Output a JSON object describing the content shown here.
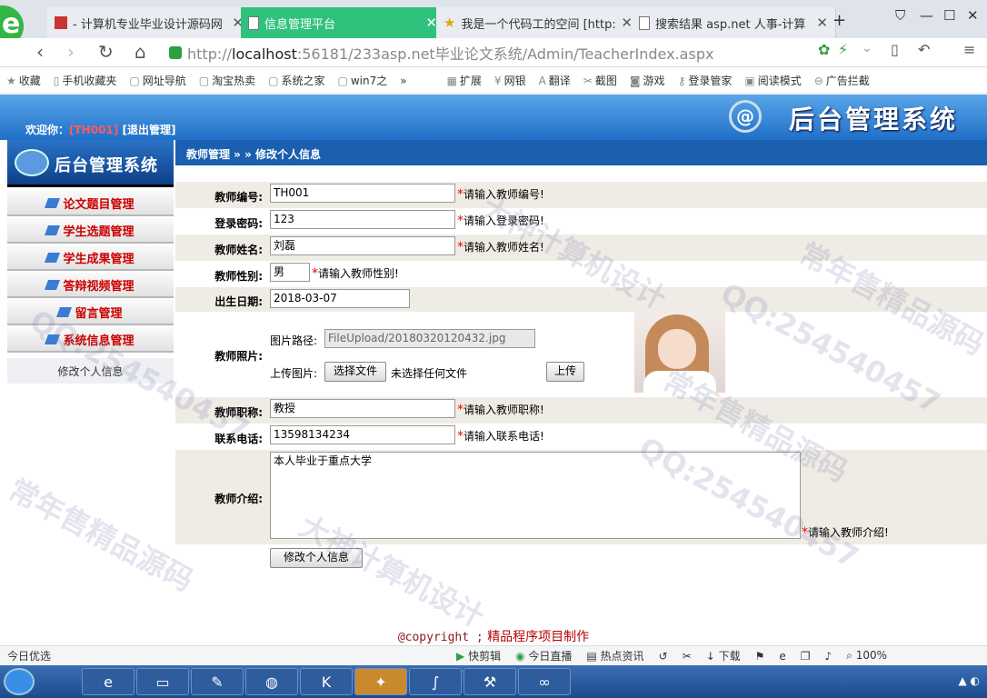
{
  "browser": {
    "tabs": [
      {
        "title": "- 计算机专业毕业设计源码网"
      },
      {
        "title": "信息管理平台"
      },
      {
        "title": "我是一个代码工的空间 [http:"
      },
      {
        "title": "搜索结果 asp.net 人事-计算"
      }
    ],
    "new_tab": "+",
    "address_host": "localhost",
    "address_prefix": "http://",
    "address_rest": ":56181/233asp.net毕业论文系统/Admin/TeacherIndex.aspx",
    "bookmarks": [
      "收藏",
      "手机收藏夹",
      "网址导航",
      "淘宝热卖",
      "系统之家",
      "win7之",
      "»",
      "扩展",
      "网银",
      "翻译",
      "截图",
      "游戏",
      "登录管家",
      "阅读模式",
      "广告拦截"
    ]
  },
  "header": {
    "logo": "后台管理系统",
    "welcome_prefix": "欢迎你：",
    "user_id": "[TH001]",
    "logout": "[退出管理]"
  },
  "breadcrumb": "教师管理 » » 修改个人信息",
  "sidebar": {
    "logo": "后台管理系统",
    "items": [
      "论文题目管理",
      "学生选题管理",
      "学生成果管理",
      "答辩视频管理",
      "留言管理",
      "系统信息管理"
    ],
    "sub_item": "修改个人信息"
  },
  "form": {
    "teacher_no": {
      "label": "教师编号:",
      "value": "TH001",
      "hint": "请输入教师编号!"
    },
    "password": {
      "label": "登录密码:",
      "value": "123",
      "hint": "请输入登录密码!"
    },
    "name": {
      "label": "教师姓名:",
      "value": "刘磊",
      "hint": "请输入教师姓名!"
    },
    "gender": {
      "label": "教师性别:",
      "value": "男",
      "hint": "请输入教师性别!"
    },
    "birth": {
      "label": "出生日期:",
      "value": "2018-03-07"
    },
    "photo": {
      "label": "教师照片:",
      "path_label": "图片路径:",
      "path_value": "FileUpload/20180320120432.jpg",
      "upload_label": "上传图片:",
      "choose_button": "选择文件",
      "no_file": "未选择任何文件",
      "upload_button": "上传"
    },
    "title": {
      "label": "教师职称:",
      "value": "教授",
      "hint": "请输入教师职称!"
    },
    "phone": {
      "label": "联系电话:",
      "value": "13598134234",
      "hint": "请输入联系电话!"
    },
    "intro": {
      "label": "教师介绍:",
      "value": "本人毕业于重点大学",
      "hint": "请输入教师介绍!"
    },
    "submit": "修改个人信息"
  },
  "footer": {
    "copyright": "@copyright ;",
    "text": "精品程序项目制作"
  },
  "status_bar": {
    "left": "今日优选",
    "items": [
      "快剪辑",
      "今日直播",
      "热点资讯",
      "下载",
      "100%"
    ]
  },
  "watermarks": [
    "QQ:254540457",
    "大神计算机设计",
    "常年售精品源码",
    "QQ:254540457",
    "常年售精品源码",
    "大神计算机设计",
    "QQ:254540457",
    "常年售精品源码"
  ]
}
